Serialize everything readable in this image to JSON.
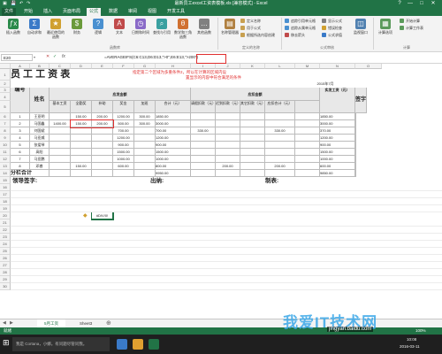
{
  "titlebar": {
    "title": "最新员工excel工资表模板.xls [兼容模式] - Excel",
    "min": "—",
    "max": "□",
    "close": "✕",
    "help": "?"
  },
  "tabs": [
    "文件",
    "开始",
    "插入",
    "页面布局",
    "公式",
    "数据",
    "审阅",
    "视图",
    "开发工具"
  ],
  "ribbon": {
    "left_buttons": [
      {
        "label": "插入函数",
        "color": "#2a8a4a"
      },
      {
        "label": "自动求和",
        "color": "#3a7ac8"
      },
      {
        "label": "最近使用的函数",
        "color": "#d0a030"
      },
      {
        "label": "财务",
        "color": "#6a9a3a"
      },
      {
        "label": "逻辑",
        "color": "#4a90d0"
      },
      {
        "label": "文本",
        "color": "#c04a4a"
      },
      {
        "label": "日期和时间",
        "color": "#8a6ac8"
      },
      {
        "label": "查找与引用",
        "color": "#3aa0a0"
      },
      {
        "label": "数学和三角函数",
        "color": "#d07030"
      },
      {
        "label": "其他函数",
        "color": "#808080"
      }
    ],
    "name_buttons": [
      {
        "label": "名称管理器",
        "color": "#b08040"
      }
    ],
    "name_small": [
      "定义名称",
      "用于公式",
      "根据所选内容创建"
    ],
    "audit_small_left": [
      "追踪引用单元格",
      "追踪从属单元格",
      "移去箭头"
    ],
    "audit_small_right": [
      "显示公式",
      "错误检查",
      "公式求值"
    ],
    "watch_button": {
      "label": "监视窗口",
      "color": "#5080b0"
    },
    "calc_button": {
      "label": "计算选项",
      "color": "#5a9a5a"
    },
    "calc_small": [
      "开始计算",
      "计算工作表"
    ],
    "groups": {
      "library": "函数库",
      "names": "定义的名称",
      "audit": "公式审核",
      "calc": "计算"
    }
  },
  "formula_bar": {
    "name_box": "E20",
    "fx": "fx",
    "formula": "=AVERAGEIFS(C6:C13,D6:D13,\">0\",E6:E13,\">200\")"
  },
  "sheet": {
    "col_headers": [
      "A",
      "B",
      "C",
      "D",
      "E",
      "F",
      "G",
      "H",
      "I",
      "J",
      "K",
      "L",
      "M",
      "N",
      "O"
    ],
    "title": "员 工 工 资 表",
    "date_label": "2015年7月",
    "annotation1": "指定第二个区域为多重条件2，所以在计算的区域内设",
    "annotation2": "置显示的内容中符合满足的条件",
    "headers": {
      "serial": "编号",
      "name": "姓名",
      "yingfa": "应发金额",
      "yingkou": "应扣金额",
      "base": "基本工资",
      "quanqin": "全勤奖",
      "buzhu": "补助",
      "jiaban": "奖金",
      "overtime": "加班",
      "total1": "合计（元）",
      "late": "请假扣款（元）",
      "absent": "迟到扣款（元）",
      "social": "其它扣款（元）",
      "tax": "应扣合计（元）",
      "actual": "实发工资（元）",
      "sign": "签字"
    },
    "rows": [
      {
        "no": "1",
        "name": "王亚明",
        "base": "",
        "quanqin": "150.00",
        "buzhu": "200.00",
        "jiaban": "1200.00",
        "overtime": "300.00",
        "total1": "1850.00",
        "late": "",
        "absent": "",
        "social": "",
        "tax": "",
        "actual": "1850.00"
      },
      {
        "no": "2",
        "name": "马国鑫",
        "base": "1400.00",
        "quanqin": "150.00",
        "buzhu": "200.00",
        "jiaban": "500.00",
        "overtime": "300.00",
        "total1": "3000.00",
        "late": "",
        "absent": "",
        "social": "",
        "tax": "",
        "actual": "3000.00"
      },
      {
        "no": "3",
        "name": "刘国斌",
        "base": "",
        "quanqin": "",
        "buzhu": "",
        "jiaban": "700.00",
        "overtime": "",
        "total1": "700.00",
        "late": "330.00",
        "absent": "",
        "social": "",
        "tax": "330.00",
        "actual": "370.00"
      },
      {
        "no": "4",
        "name": "马亚威",
        "base": "",
        "quanqin": "",
        "buzhu": "",
        "jiaban": "1200.00",
        "overtime": "",
        "total1": "1200.00",
        "late": "",
        "absent": "",
        "social": "",
        "tax": "",
        "actual": "1200.00"
      },
      {
        "no": "5",
        "name": "张爱琴",
        "base": "",
        "quanqin": "",
        "buzhu": "",
        "jiaban": "900.00",
        "overtime": "",
        "total1": "900.00",
        "late": "",
        "absent": "",
        "social": "",
        "tax": "",
        "actual": "900.00"
      },
      {
        "no": "6",
        "name": "高阳",
        "base": "",
        "quanqin": "",
        "buzhu": "",
        "jiaban": "1500.00",
        "overtime": "",
        "total1": "1500.00",
        "late": "",
        "absent": "",
        "social": "",
        "tax": "",
        "actual": "1500.00"
      },
      {
        "no": "7",
        "name": "马亚鹏",
        "base": "",
        "quanqin": "",
        "buzhu": "",
        "jiaban": "1000.00",
        "overtime": "",
        "total1": "1000.00",
        "late": "",
        "absent": "",
        "social": "",
        "tax": "",
        "actual": "1000.00"
      },
      {
        "no": "8",
        "name": "邓睿",
        "base": "",
        "quanqin": "150.00",
        "buzhu": "",
        "jiaban": "600.00",
        "overtime": "",
        "total1": "800.00",
        "late": "",
        "absent": "200.00",
        "social": "",
        "tax": "200.00",
        "actual": "600.00"
      }
    ],
    "subtotal_label": "分栏合计",
    "subtotal_total": "9950.00",
    "subtotal_actual": "9850.00",
    "leader_sign": "领导签字:",
    "cashier": "出纳:",
    "maker": "制表:",
    "error_cell": "#DIV/0!",
    "row_numbers": [
      "1",
      "2",
      "3",
      "4",
      "5",
      "6",
      "7",
      "8",
      "9",
      "10",
      "11",
      "12",
      "13",
      "14",
      "15",
      "16",
      "17",
      "18",
      "19",
      "20",
      "21",
      "22",
      "23",
      "24",
      "25",
      "26",
      "27",
      "28",
      "29",
      "30"
    ]
  },
  "sheet_tabs": [
    "5月工资",
    "Sheet3"
  ],
  "status": {
    "ready": "就绪",
    "zoom": "100%"
  },
  "taskbar": {
    "search": "我是 Cortana，小娜。有问题尽管问我。",
    "time": "10:08",
    "date": "2016-03-11"
  },
  "watermark": "我爱IT技术网",
  "watermark_url": "jingyan.baidu.com"
}
